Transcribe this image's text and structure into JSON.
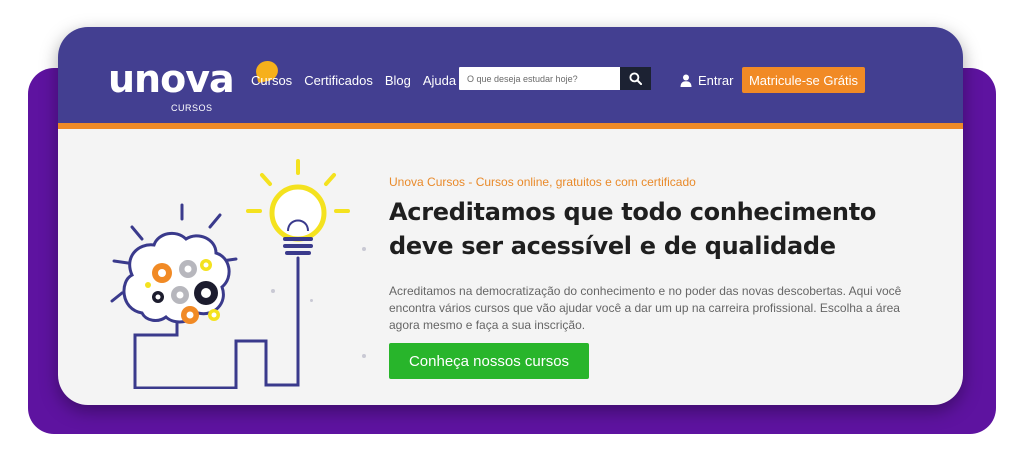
{
  "brand": {
    "name": "unova",
    "sub": "CURSOS"
  },
  "nav": {
    "items": [
      "Cursos",
      "Certificados",
      "Blog",
      "Ajuda"
    ]
  },
  "search": {
    "placeholder": "O que deseja estudar hoje?",
    "icon": "search-icon"
  },
  "login": {
    "label": "Entrar",
    "icon": "user-icon"
  },
  "cta_top": {
    "label": "Matricule-se Grátis"
  },
  "hero": {
    "kicker": "Unova Cursos - Cursos online, gratuitos e com certificado",
    "headline": "Acreditamos que todo conhecimento deve ser acessível e de qualidade",
    "description": "Acreditamos na democratização do conhecimento e no poder das novas descobertas. Aqui você encontra vários cursos que vão ajudar você a dar um up na carreira profissional. Escolha a área agora mesmo e faça a sua inscrição.",
    "button": "Conheça nossos cursos"
  },
  "colors": {
    "header": "#433f91",
    "accent_orange": "#f18a25",
    "accent_green": "#28b52b",
    "backdrop_purple": "#5e13a0",
    "illustration_navy": "#3a3a8c",
    "illustration_yellow": "#f4e21f"
  }
}
